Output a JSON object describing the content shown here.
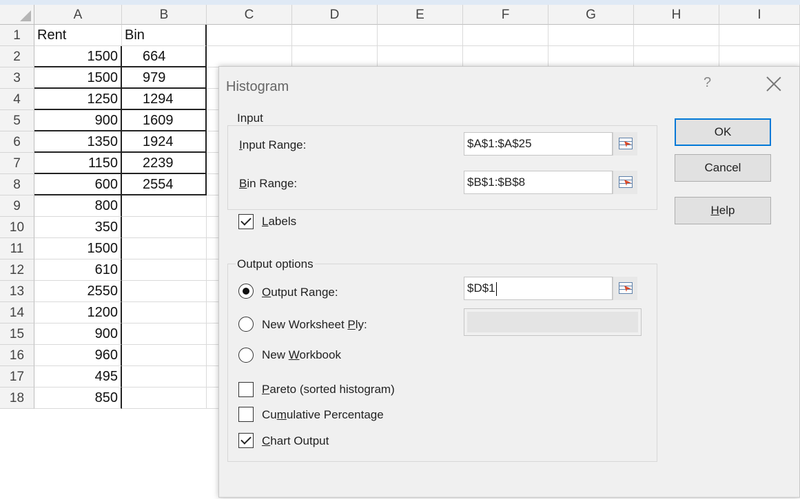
{
  "columns": [
    "A",
    "B",
    "C",
    "D",
    "E",
    "F",
    "G",
    "H",
    "I"
  ],
  "rows": [
    {
      "n": "1",
      "a": "Rent",
      "b": "Bin"
    },
    {
      "n": "2",
      "a": "1500",
      "b": "664"
    },
    {
      "n": "3",
      "a": "1500",
      "b": "979"
    },
    {
      "n": "4",
      "a": "1250",
      "b": "1294"
    },
    {
      "n": "5",
      "a": "900",
      "b": "1609"
    },
    {
      "n": "6",
      "a": "1350",
      "b": "1924"
    },
    {
      "n": "7",
      "a": "1150",
      "b": "2239"
    },
    {
      "n": "8",
      "a": "600",
      "b": "2554"
    },
    {
      "n": "9",
      "a": "800",
      "b": ""
    },
    {
      "n": "10",
      "a": "350",
      "b": ""
    },
    {
      "n": "11",
      "a": "1500",
      "b": ""
    },
    {
      "n": "12",
      "a": "610",
      "b": ""
    },
    {
      "n": "13",
      "a": "2550",
      "b": ""
    },
    {
      "n": "14",
      "a": "1200",
      "b": ""
    },
    {
      "n": "15",
      "a": "900",
      "b": ""
    },
    {
      "n": "16",
      "a": "960",
      "b": ""
    },
    {
      "n": "17",
      "a": "495",
      "b": ""
    },
    {
      "n": "18",
      "a": "850",
      "b": ""
    }
  ],
  "dialog": {
    "title": "Histogram",
    "help_glyph": "?",
    "input_group": "Input",
    "input_range_label": [
      "I",
      "nput Range:"
    ],
    "input_range_value": "$A$1:$A$25",
    "bin_range_label": [
      "B",
      "in Range:"
    ],
    "bin_range_value": "$B$1:$B$8",
    "labels_label": [
      "L",
      "abels"
    ],
    "labels_checked": true,
    "ok": "OK",
    "cancel": "Cancel",
    "help": [
      "H",
      "elp"
    ],
    "output_group": "Output options",
    "output_range_label": [
      "O",
      "utput Range:"
    ],
    "output_range_value": "$D$1",
    "new_ply_label": [
      "New Worksheet ",
      "P",
      "ly:"
    ],
    "new_workbook_label": [
      "New ",
      "W",
      "orkbook"
    ],
    "selected_output": "output_range",
    "pareto_label": [
      "P",
      "areto (sorted histogram)"
    ],
    "pareto_checked": false,
    "cumulative_label": [
      "Cu",
      "m",
      "ulative Percentage"
    ],
    "cumulative_checked": false,
    "chart_label": [
      "C",
      "hart Output"
    ],
    "chart_checked": true
  }
}
